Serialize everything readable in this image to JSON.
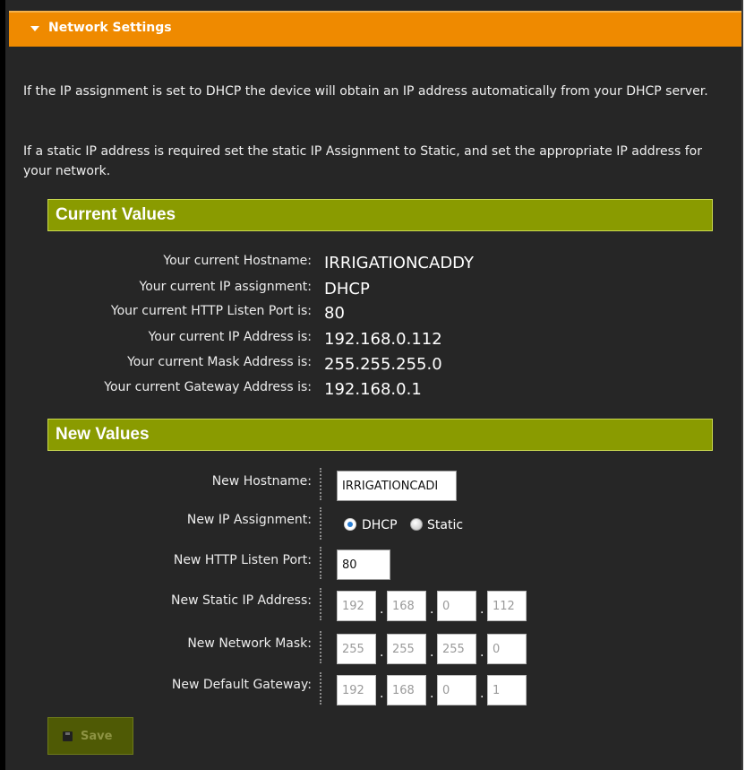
{
  "header": {
    "title": "Network Settings"
  },
  "intro": {
    "para1": "If the IP assignment is set to DHCP the device will obtain an IP address automatically from your DHCP server.",
    "para2": "If a static IP address is required set the static IP Assignment to Static, and set the appropriate IP address for your network."
  },
  "current": {
    "title": "Current Values",
    "rows": [
      {
        "label": "Your current Hostname:",
        "value": "IRRIGATIONCADDY"
      },
      {
        "label": "Your current IP assignment:",
        "value": "DHCP"
      },
      {
        "label": "Your current HTTP Listen Port is:",
        "value": "80"
      },
      {
        "label": "Your current IP Address is:",
        "value": "192.168.0.112"
      },
      {
        "label": "Your current Mask Address is:",
        "value": "255.255.255.0"
      },
      {
        "label": "Your current Gateway Address is:",
        "value": "192.168.0.1"
      }
    ]
  },
  "newvals": {
    "title": "New Values",
    "hostname_label": "New Hostname:",
    "hostname_value": "IRRIGATIONCADI",
    "assignment_label": "New IP Assignment:",
    "assignment_options": [
      "DHCP",
      "Static"
    ],
    "assignment_selected": "DHCP",
    "port_label": "New HTTP Listen Port:",
    "port_value": "80",
    "ip_label": "New Static IP Address:",
    "ip": [
      "192",
      "168",
      "0",
      "112"
    ],
    "mask_label": "New Network Mask:",
    "mask": [
      "255",
      "255",
      "255",
      "0"
    ],
    "gateway_label": "New Default Gateway:",
    "gateway": [
      "192",
      "168",
      "0",
      "1"
    ],
    "separator": "."
  },
  "save": {
    "label": "Save",
    "icon": "floppy-disk-icon"
  },
  "colors": {
    "header": "#ef8a00",
    "section": "#8a9b00",
    "background": "#262626"
  }
}
